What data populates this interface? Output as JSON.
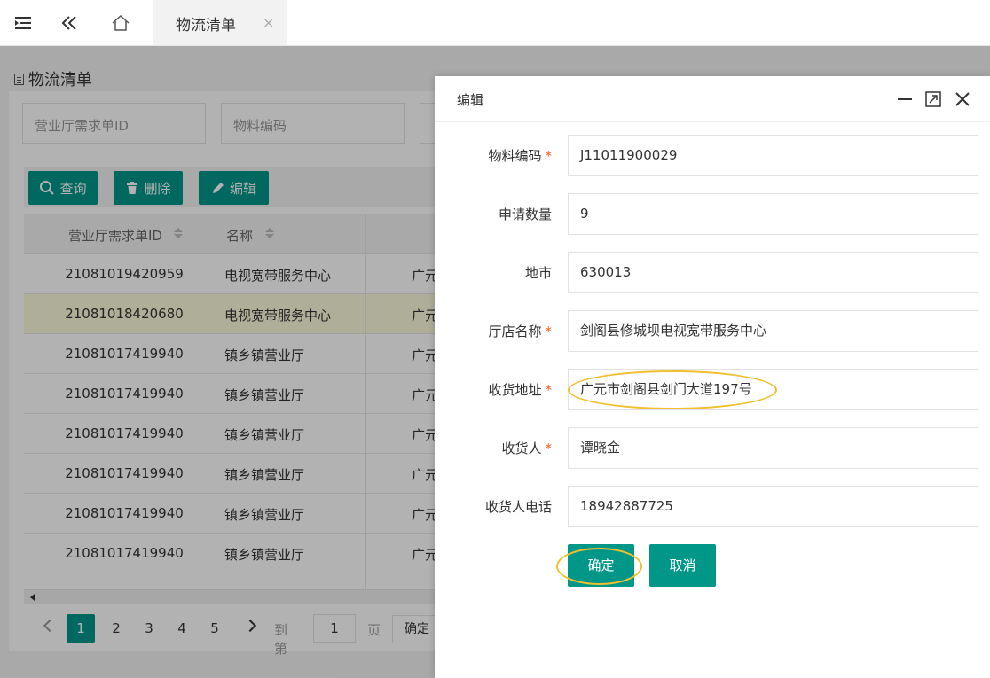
{
  "topbar": {
    "icons": [
      "menu-icon",
      "double-chevron-left-icon",
      "home-icon",
      "close-icon"
    ],
    "tab_label": "物流清单",
    "tab_close": "×"
  },
  "page": {
    "title": "物流清单",
    "search": {
      "order_id_placeholder": "营业厅需求单ID",
      "material_code_placeholder": "物料编码"
    },
    "actions": {
      "query_label": "查询",
      "delete_label": "删除",
      "edit_label": "编辑"
    },
    "table": {
      "headers": [
        "营业厅需求单ID",
        "名称"
      ],
      "rows": [
        {
          "id": "21081019420959",
          "name": "电视宽带服务中心",
          "city": "广元"
        },
        {
          "id": "21081018420680",
          "name": "电视宽带服务中心",
          "city": "广元"
        },
        {
          "id": "21081017419940",
          "name": "镇乡镇营业厅",
          "city": "广元"
        },
        {
          "id": "21081017419940",
          "name": "镇乡镇营业厅",
          "city": "广元"
        },
        {
          "id": "21081017419940",
          "name": "镇乡镇营业厅",
          "city": "广元"
        },
        {
          "id": "21081017419940",
          "name": "镇乡镇营业厅",
          "city": "广元"
        },
        {
          "id": "21081017419940",
          "name": "镇乡镇营业厅",
          "city": "广元"
        },
        {
          "id": "21081017419940",
          "name": "镇乡镇营业厅",
          "city": "广元"
        }
      ],
      "selected_row_index": 1
    },
    "pagination": {
      "pages": [
        "1",
        "2",
        "3",
        "4",
        "5"
      ],
      "current": "1",
      "goto_label": "到第",
      "goto_value": "1",
      "page_unit": "页",
      "confirm_label": "确定"
    }
  },
  "modal": {
    "title": "编辑",
    "icons": [
      "minimize-icon",
      "maximize-icon",
      "close-icon"
    ],
    "fields": [
      {
        "label": "物料编码",
        "required": true,
        "value": "J11011900029"
      },
      {
        "label": "申请数量",
        "required": false,
        "value": "9"
      },
      {
        "label": "地市",
        "required": false,
        "value": "630013"
      },
      {
        "label": "厅店名称",
        "required": true,
        "value": "剑阁县修城坝电视宽带服务中心"
      },
      {
        "label": "收货地址",
        "required": true,
        "value": "广元市剑阁县剑门大道197号"
      },
      {
        "label": "收货人",
        "required": true,
        "value": "谭晓金"
      },
      {
        "label": "收货人电话",
        "required": false,
        "value": "18942887725"
      }
    ],
    "confirm_label": "确定",
    "cancel_label": "取消",
    "required_mark": "*",
    "highlight_color": "#f0c030"
  },
  "colors": {
    "accent": "#009688",
    "required": "#ff5722",
    "selected_row": "#fbf9db"
  }
}
